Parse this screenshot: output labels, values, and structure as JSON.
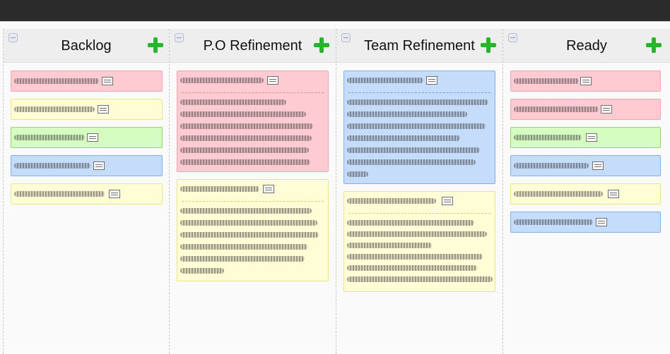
{
  "board": {
    "columns": [
      {
        "title": "Backlog",
        "collapse_icon": "collapse-icon",
        "add_icon": "plus-icon"
      },
      {
        "title": "P.O Refinement",
        "collapse_icon": "collapse-icon",
        "add_icon": "plus-icon"
      },
      {
        "title": "Team Refinement",
        "collapse_icon": "collapse-icon",
        "add_icon": "plus-icon"
      },
      {
        "title": "Ready",
        "collapse_icon": "collapse-icon",
        "add_icon": "plus-icon"
      }
    ]
  },
  "cards": {
    "backlog": [
      {
        "color": "pink"
      },
      {
        "color": "yellow"
      },
      {
        "color": "green"
      },
      {
        "color": "blue"
      },
      {
        "color": "yellow"
      }
    ],
    "po_refinement": [
      {
        "color": "pink",
        "expanded": true
      },
      {
        "color": "yellow",
        "expanded": true
      }
    ],
    "team_refinement": [
      {
        "color": "blue",
        "expanded": true
      },
      {
        "color": "yellow",
        "expanded": true
      }
    ],
    "ready": [
      {
        "color": "pink"
      },
      {
        "color": "pink"
      },
      {
        "color": "green"
      },
      {
        "color": "blue"
      },
      {
        "color": "yellow"
      },
      {
        "color": "blue"
      }
    ]
  },
  "colors": {
    "pink": "#ffcbd3",
    "yellow": "#fffdd5",
    "green": "#d6fdc1",
    "blue": "#c5ddfb",
    "add_button": "#27b52c",
    "topbar": "#2b2b2b"
  },
  "note": "Card titles and descriptions are illegible (scribbled) in the screenshot; they are drawn as unreadable strokes."
}
